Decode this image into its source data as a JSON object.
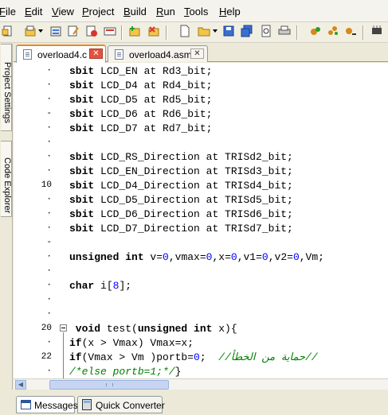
{
  "menubar": {
    "items": [
      {
        "mn": "F",
        "rest": "ile"
      },
      {
        "mn": "E",
        "rest": "dit"
      },
      {
        "mn": "V",
        "rest": "iew"
      },
      {
        "mn": "P",
        "rest": "roject"
      },
      {
        "mn": "B",
        "rest": "uild"
      },
      {
        "mn": "R",
        "rest": "un"
      },
      {
        "mn": "T",
        "rest": "ools"
      },
      {
        "mn": "H",
        "rest": "elp"
      }
    ]
  },
  "side_tabs": {
    "project_settings": "Project Settings",
    "code_explorer": "Code Explorer"
  },
  "tabs": [
    {
      "label": "overload4.c",
      "close": "✕"
    },
    {
      "label": "overload4.asm",
      "close": "✕"
    }
  ],
  "code_lines": [
    {
      "ln": "·",
      "segs": [
        [
          "kw",
          "sbit"
        ],
        [
          "p",
          " LCD_EN at Rd3_bit;"
        ]
      ]
    },
    {
      "ln": "·",
      "segs": [
        [
          "kw",
          "sbit"
        ],
        [
          "p",
          " LCD_D4 at Rd4_bit;"
        ]
      ]
    },
    {
      "ln": "·",
      "segs": [
        [
          "kw",
          "sbit"
        ],
        [
          "p",
          " LCD_D5 at Rd5_bit;"
        ]
      ]
    },
    {
      "ln": "-",
      "segs": [
        [
          "kw",
          "sbit"
        ],
        [
          "p",
          " LCD_D6 at Rd6_bit;"
        ]
      ]
    },
    {
      "ln": "·",
      "segs": [
        [
          "kw",
          "sbit"
        ],
        [
          "p",
          " LCD_D7 at Rd7_bit;"
        ]
      ]
    },
    {
      "ln": "·",
      "segs": []
    },
    {
      "ln": "·",
      "segs": [
        [
          "kw",
          "sbit"
        ],
        [
          "p",
          " LCD_RS_Direction at TRISd2_bit;"
        ]
      ]
    },
    {
      "ln": "·",
      "segs": [
        [
          "kw",
          "sbit"
        ],
        [
          "p",
          " LCD_EN_Direction at TRISd3_bit;"
        ]
      ]
    },
    {
      "ln": "10",
      "segs": [
        [
          "kw",
          "sbit"
        ],
        [
          "p",
          " LCD_D4_Direction at TRISd4_bit;"
        ]
      ]
    },
    {
      "ln": "·",
      "segs": [
        [
          "kw",
          "sbit"
        ],
        [
          "p",
          " LCD_D5_Direction at TRISd5_bit;"
        ]
      ]
    },
    {
      "ln": "·",
      "segs": [
        [
          "kw",
          "sbit"
        ],
        [
          "p",
          " LCD_D6_Direction at TRISd6_bit;"
        ]
      ]
    },
    {
      "ln": "·",
      "segs": [
        [
          "kw",
          "sbit"
        ],
        [
          "p",
          " LCD_D7_Direction at TRISd7_bit;"
        ]
      ]
    },
    {
      "ln": "-",
      "segs": []
    },
    {
      "ln": "·",
      "segs": [
        [
          "kw",
          "unsigned int"
        ],
        [
          "p",
          " v="
        ],
        [
          "num",
          "0"
        ],
        [
          "p",
          ",vmax="
        ],
        [
          "num",
          "0"
        ],
        [
          "p",
          ",x="
        ],
        [
          "num",
          "0"
        ],
        [
          "p",
          ",v1="
        ],
        [
          "num",
          "0"
        ],
        [
          "p",
          ",v2="
        ],
        [
          "num",
          "0"
        ],
        [
          "p",
          ",Vm;"
        ]
      ]
    },
    {
      "ln": "·",
      "segs": []
    },
    {
      "ln": "·",
      "segs": [
        [
          "kw",
          "char"
        ],
        [
          "p",
          " i["
        ],
        [
          "num",
          "8"
        ],
        [
          "p",
          "];"
        ]
      ]
    },
    {
      "ln": "·",
      "segs": []
    },
    {
      "ln": "·",
      "segs": []
    },
    {
      "ln": "20",
      "segs": [
        [
          "kw",
          " void"
        ],
        [
          "p",
          " test("
        ],
        [
          "kw",
          "unsigned int"
        ],
        [
          "p",
          " x){"
        ]
      ]
    },
    {
      "ln": "·",
      "segs": [
        [
          "kw",
          "if"
        ],
        [
          "p",
          "(x > Vmax) Vmax=x;"
        ]
      ]
    },
    {
      "ln": "22",
      "segs": [
        [
          "kw",
          "if"
        ],
        [
          "p",
          "(Vmax > Vm )portb="
        ],
        [
          "num",
          "0"
        ],
        [
          "p",
          ";  "
        ],
        [
          "cmt",
          "//حماية من الخطأ//"
        ]
      ]
    },
    {
      "ln": "·",
      "segs": [
        [
          "cmt",
          "/*else portb=1;*/"
        ],
        [
          "p",
          "}"
        ]
      ]
    }
  ],
  "scrollbar": {
    "left_arrow": "◀"
  },
  "bottom_tabs": {
    "messages": "Messages",
    "quick_converter": "Quick Converter"
  }
}
